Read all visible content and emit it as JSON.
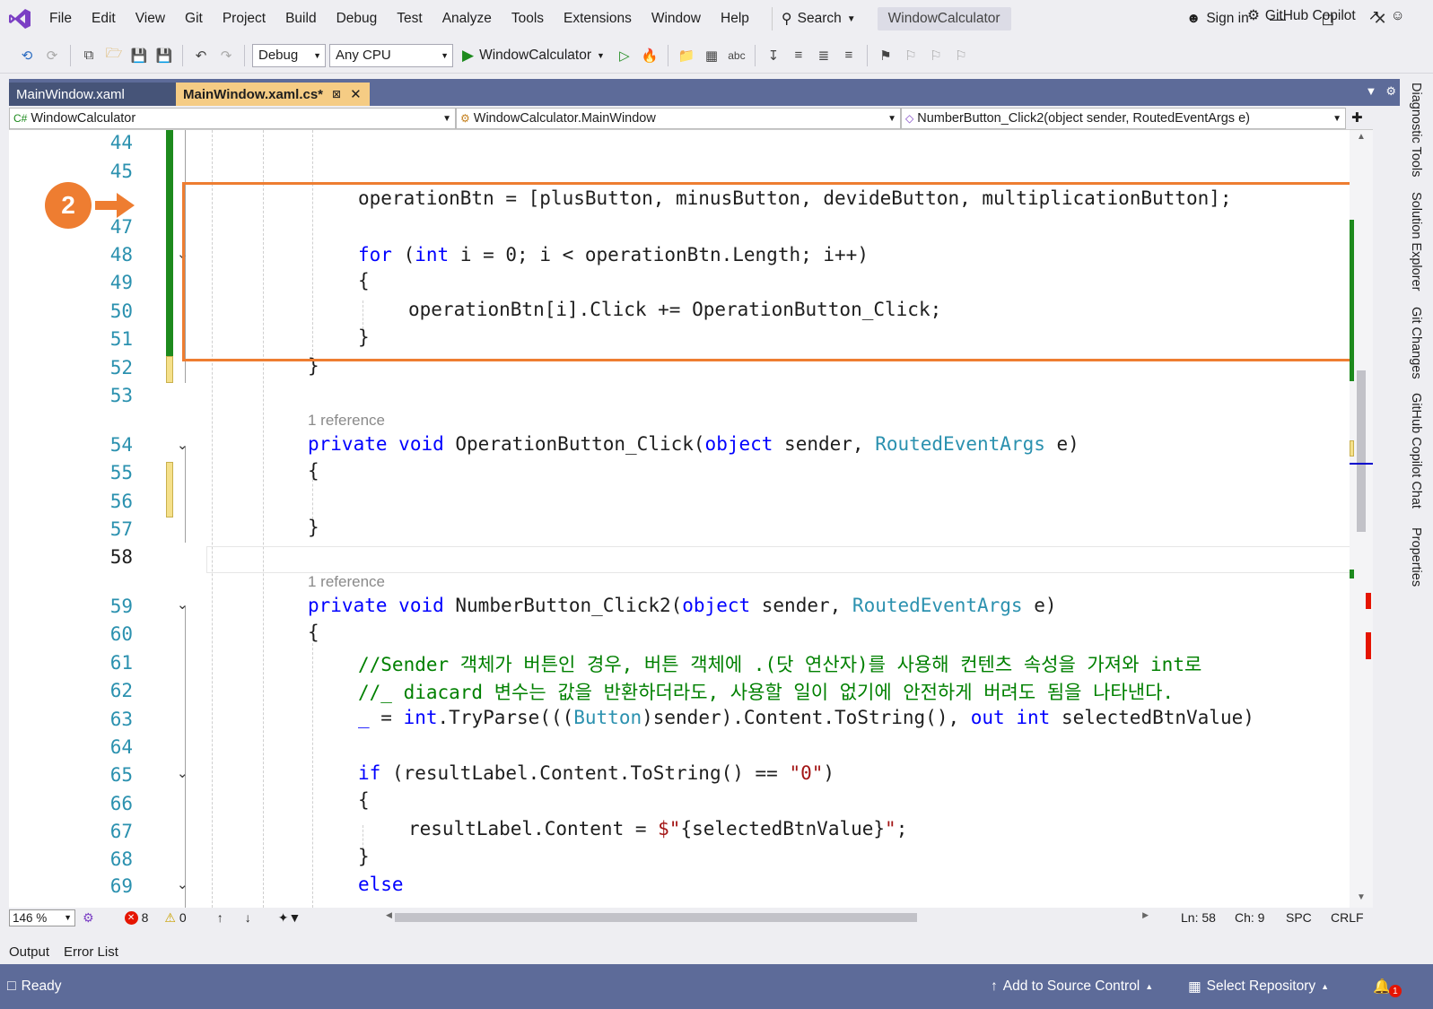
{
  "menu": {
    "items": [
      "File",
      "Edit",
      "View",
      "Git",
      "Project",
      "Build",
      "Debug",
      "Test",
      "Analyze",
      "Tools",
      "Extensions",
      "Window",
      "Help"
    ],
    "search_label": "Search",
    "solution_title": "WindowCalculator",
    "sign_in": "Sign in"
  },
  "toolbar": {
    "configuration": "Debug",
    "platform": "Any CPU",
    "run_target": "WindowCalculator",
    "copilot": "GitHub Copilot"
  },
  "tabs": [
    {
      "label": "MainWindow.xaml",
      "active": false
    },
    {
      "label": "MainWindow.xaml.cs*",
      "active": true
    }
  ],
  "navbar": {
    "project": "WindowCalculator",
    "type": "WindowCalculator.MainWindow",
    "member": "NumberButton_Click2(object sender, RoutedEventArgs e)"
  },
  "editor": {
    "line_numbers": [
      "44",
      "45",
      "47",
      "48",
      "49",
      "50",
      "51",
      "52",
      "53",
      "54",
      "55",
      "56",
      "57",
      "58",
      "59",
      "60",
      "61",
      "62",
      "63",
      "64",
      "65",
      "66",
      "67",
      "68",
      "69"
    ],
    "hidden_line_badge": "2",
    "current_line": "58",
    "reference_label_1": "1 reference",
    "reference_label_2": "1 reference",
    "code": {
      "l46_a": "operationBtn = [plusButton, minusButton, devideButton, multiplicationButton];",
      "l48_kw1": "for",
      "l48_a": " (",
      "l48_kw2": "int",
      "l48_b": " i = 0; i < operationBtn.Length; i++)",
      "l49": "{",
      "l50": "operationBtn[i].Click += OperationButton_Click;",
      "l51": "}",
      "l52": "}",
      "l54_kw1": "private",
      "l54_kw2": "void",
      "l54_a": " OperationButton_Click(",
      "l54_kw3": "object",
      "l54_b": " sender, ",
      "l54_ty": "RoutedEventArgs",
      "l54_c": " e)",
      "l55": "{",
      "l57": "}",
      "l59_kw1": "private",
      "l59_kw2": "void",
      "l59_a": " NumberButton_Click2(",
      "l59_kw3": "object",
      "l59_b": " sender, ",
      "l59_ty": "RoutedEventArgs",
      "l59_c": " e)",
      "l60": "{",
      "l61": "//Sender 객체가 버튼인 경우, 버튼 객체에 .(닷 연산자)를 사용해 컨텐츠 속성을 가져와 int로",
      "l62": "//_ diacard 변수는 값을 반환하더라도, 사용할 일이 없기에 안전하게 버려도 됨을 나타낸다.",
      "l63_a": "_",
      "l63_b": " = ",
      "l63_kw1": "int",
      "l63_c": ".TryParse(((",
      "l63_ty": "Button",
      "l63_d": ")sender).Content.ToString(), ",
      "l63_kw2": "out",
      "l63_e": " ",
      "l63_kw3": "int",
      "l63_f": " selectedBtnValue)",
      "l65_kw": "if",
      "l65_a": " (resultLabel.Content.ToString() == ",
      "l65_st": "\"0\"",
      "l65_b": ")",
      "l66": "{",
      "l67_a": "resultLabel.Content = ",
      "l67_st": "$\"",
      "l67_b": "{selectedBtnValue}",
      "l67_st2": "\"",
      "l67_c": ";",
      "l68": "}",
      "l69_kw": "else"
    }
  },
  "editor_status": {
    "zoom": "146 %",
    "errors": "8",
    "warnings": "0",
    "line": "Ln: 58",
    "col": "Ch: 9",
    "whitespace": "SPC",
    "line_ending": "CRLF"
  },
  "side_tabs": [
    "Diagnostic Tools",
    "Solution Explorer",
    "Git Changes",
    "GitHub Copilot Chat",
    "Properties"
  ],
  "bottom_tabs": [
    "Output",
    "Error List"
  ],
  "statusbar": {
    "ready": "Ready",
    "source_control": "Add to Source Control",
    "repository": "Select Repository",
    "notification_count": "1"
  },
  "colors": {
    "accent": "#5d6b99",
    "active_tab": "#f5cc84",
    "callout": "#ee7d31",
    "keyword": "#0000ff",
    "type": "#2b91af",
    "comment": "#008000",
    "string": "#a31515",
    "change_saved": "#1d8a1d",
    "change_unsaved": "#f5e08a"
  }
}
